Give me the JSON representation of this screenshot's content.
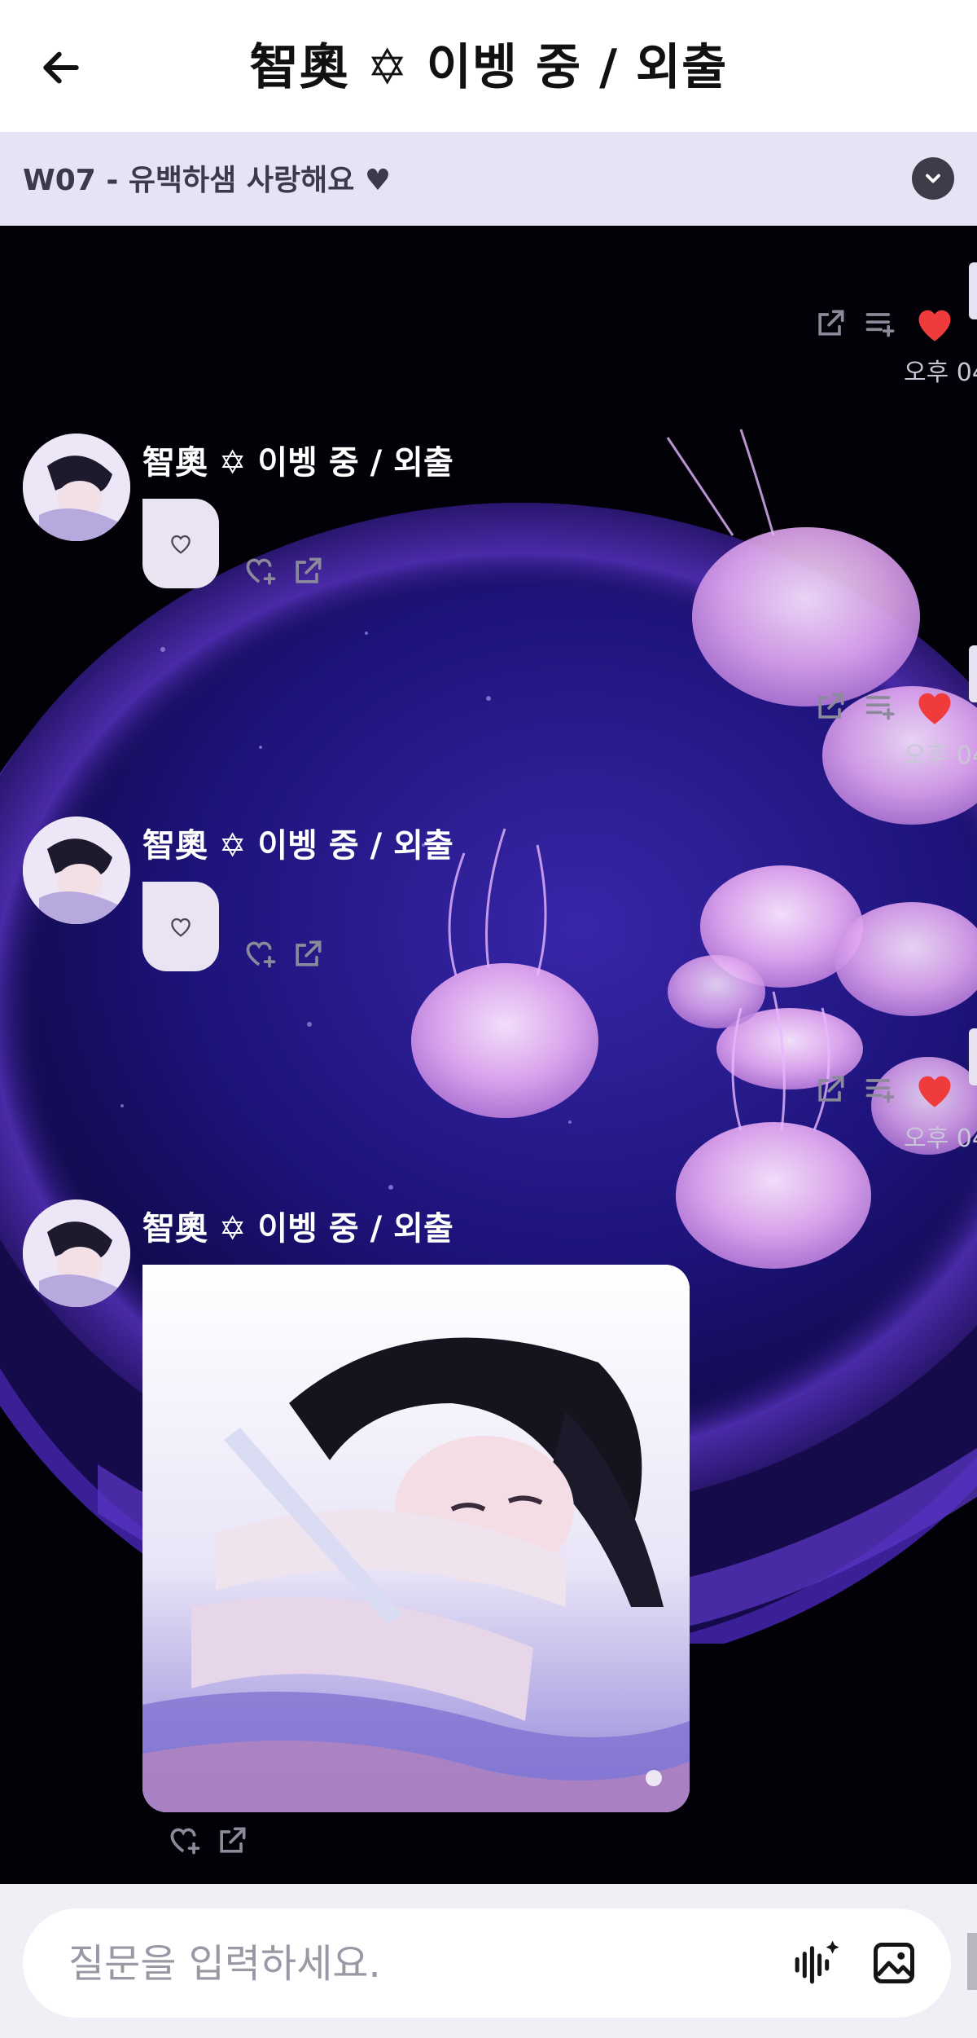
{
  "header": {
    "title": "智奧 ✡ 이벵 중 / 외출"
  },
  "notice": {
    "text": "W07 - 유백하샘 사랑해요 ♥"
  },
  "own_messages": [
    {
      "time": "오후 04"
    },
    {
      "time": "오후 04"
    },
    {
      "time": "오후 04"
    }
  ],
  "incoming": [
    {
      "sender": "智奧 ✡ 이벵 중 / 외출",
      "type": "heart"
    },
    {
      "sender": "智奧 ✡ 이벵 중 / 외출",
      "type": "heart"
    },
    {
      "sender": "智奧 ✡ 이벵 중 / 외출",
      "type": "image"
    }
  ],
  "input": {
    "placeholder": "질문을 입력하세요."
  },
  "colors": {
    "header_bg": "#ffffff",
    "notice_bg": "#e6e3f5",
    "like_red": "#ef3b3b",
    "bubble": "#e9e3f2",
    "input_bar_bg": "#f1eff5"
  }
}
